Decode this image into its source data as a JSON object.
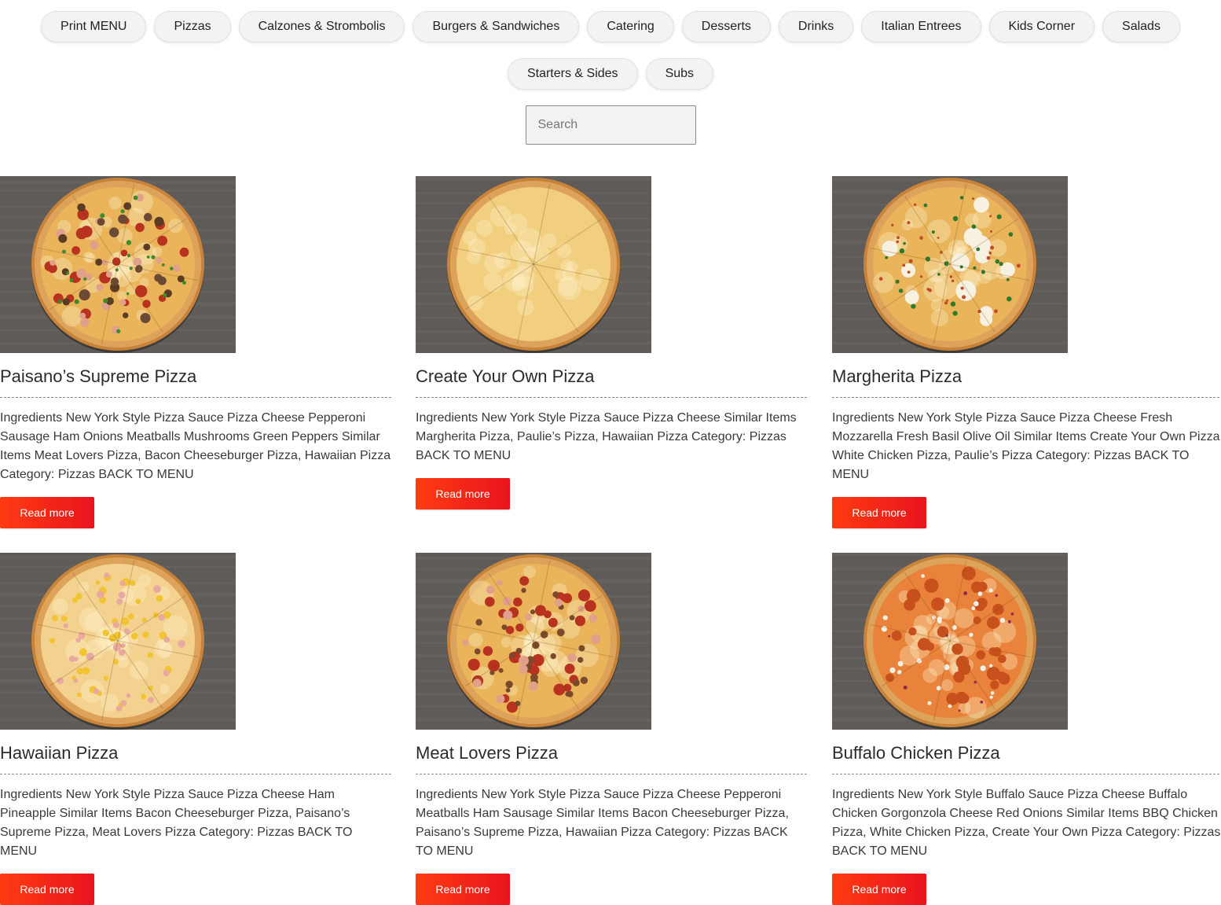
{
  "nav": {
    "row1": [
      "Print MENU",
      "Pizzas",
      "Calzones & Strombolis",
      "Burgers & Sandwiches",
      "Catering",
      "Desserts",
      "Drinks",
      "Italian Entrees",
      "Kids Corner",
      "Salads"
    ],
    "row2": [
      "Starters & Sides",
      "Subs"
    ]
  },
  "search": {
    "placeholder": "Search"
  },
  "cards": [
    {
      "title": "Paisano’s Supreme Pizza",
      "desc": "Ingredients New York Style Pizza Sauce Pizza Cheese Pepperoni Sausage Ham Onions Meatballs Mushrooms Green Peppers Similar Items  Meat Lovers Pizza,  Bacon Cheeseburger Pizza, Hawaiian Pizza Category: Pizzas BACK TO MENU",
      "button": "Read more",
      "topping": "supreme"
    },
    {
      "title": "Create Your Own Pizza",
      "desc": "Ingredients New York Style Pizza Sauce Pizza Cheese Similar Items  Margherita Pizza, Paulie’s Pizza, Hawaiian Pizza Category: Pizzas BACK TO MENU",
      "button": "Read more",
      "topping": "cheese"
    },
    {
      "title": "Margherita Pizza",
      "desc": "Ingredients New York Style Pizza Sauce Pizza Cheese Fresh Mozzarella Fresh Basil Olive Oil Similar Items Create Your Own Pizza, White Chicken Pizza, Paulie’s Pizza Category: Pizzas BACK TO MENU",
      "button": "Read more",
      "topping": "margherita"
    },
    {
      "title": "Hawaiian Pizza",
      "desc": "Ingredients New York Style Pizza Sauce Pizza Cheese Ham Pineapple Similar Items Bacon Cheeseburger Pizza, Paisano’s Supreme Pizza, Meat Lovers Pizza Category: Pizzas BACK TO MENU",
      "button": "Read more",
      "topping": "hawaiian"
    },
    {
      "title": "Meat Lovers Pizza",
      "desc": "Ingredients New York Style Pizza Sauce Pizza Cheese Pepperoni Meatballs Ham Sausage Similar Items Bacon Cheeseburger Pizza, Paisano’s Supreme Pizza, Hawaiian Pizza   Category: Pizzas BACK TO MENU",
      "button": "Read more",
      "topping": "meat"
    },
    {
      "title": "Buffalo Chicken Pizza",
      "desc": "Ingredients New York Style Buffalo Sauce Pizza Cheese Buffalo Chicken Gorgonzola Cheese Red Onions Similar Items BBQ Chicken Pizza, White Chicken Pizza, Create Your Own Pizza Category: Pizzas BACK TO MENU",
      "button": "Read more",
      "topping": "buffalo"
    }
  ],
  "colors": {
    "button_gradient_start": "#ff3b12",
    "button_gradient_end": "#e8141d",
    "nav_pill_bg": "#f3f3f3",
    "crust": "#d9963f",
    "cheese": "#f2d58b"
  }
}
